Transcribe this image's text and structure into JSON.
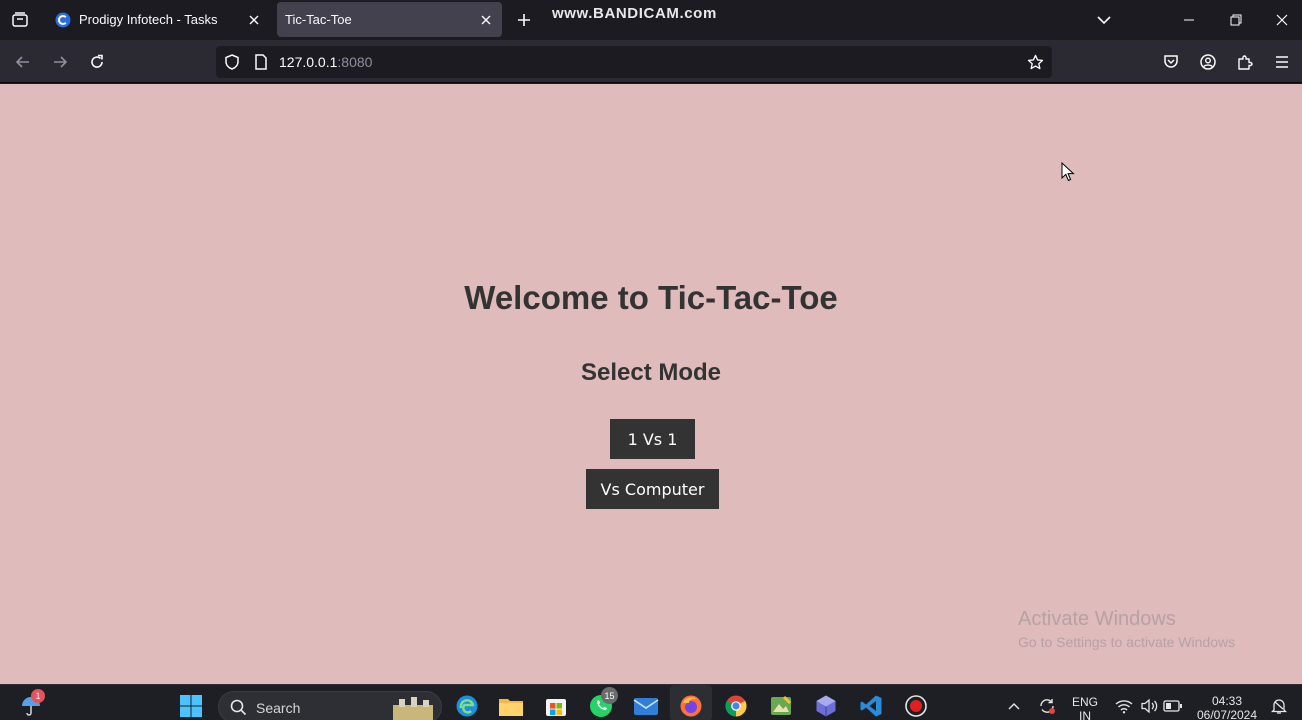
{
  "browser": {
    "tabs": [
      {
        "title": "Prodigy Infotech - Tasks",
        "active": false
      },
      {
        "title": "Tic-Tac-Toe",
        "active": true
      }
    ],
    "watermark": "www.BANDICAM.com",
    "url": {
      "host": "127.0.0.1",
      "port": ":8080"
    }
  },
  "page": {
    "heading": "Welcome to Tic-Tac-Toe",
    "subheading": "Select Mode",
    "buttons": {
      "one_vs_one": "1 Vs 1",
      "vs_computer": "Vs Computer"
    },
    "activation": {
      "title": "Activate Windows",
      "hint": "Go to Settings to activate Windows"
    },
    "background_color": "#dfbbbc",
    "button_color": "#333333"
  },
  "taskbar": {
    "search_label": "Search",
    "weather_badge": "1",
    "whatsapp_badge": "15",
    "language": {
      "line1": "ENG",
      "line2": "IN"
    },
    "time": "04:33",
    "date": "06/07/2024"
  }
}
